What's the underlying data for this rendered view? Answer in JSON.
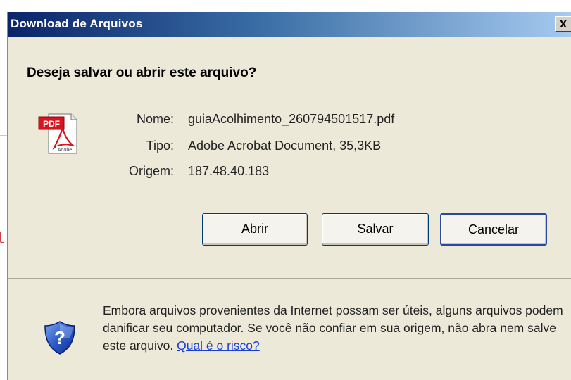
{
  "dialog": {
    "title": "Download de Arquivos",
    "close_label": "x",
    "question": "Deseja salvar ou abrir este arquivo?"
  },
  "file": {
    "icon": "pdf-file-icon",
    "icon_badge": "PDF",
    "icon_brand": "Adobe",
    "name_label": "Nome:",
    "name_value": "guiaAcolhimento_260794501517.pdf",
    "type_label": "Tipo:",
    "type_value": "Adobe Acrobat Document, 35,3KB",
    "origin_label": "Origem:",
    "origin_value": "187.48.40.183"
  },
  "buttons": {
    "open": "Abrir",
    "save": "Salvar",
    "cancel": "Cancelar"
  },
  "warning": {
    "icon": "security-shield-question-icon",
    "text": "Embora arquivos provenientes da Internet possam ser úteis, alguns arquivos podem danificar seu computador. Se você não confiar em sua origem, não abra nem salve este arquivo.",
    "link": "Qual é o risco?"
  },
  "colors": {
    "title_gradient_start": "#0a246a",
    "title_gradient_end": "#a6caf0",
    "dialog_background": "#ece9d8",
    "link": "#1a3fd6"
  }
}
